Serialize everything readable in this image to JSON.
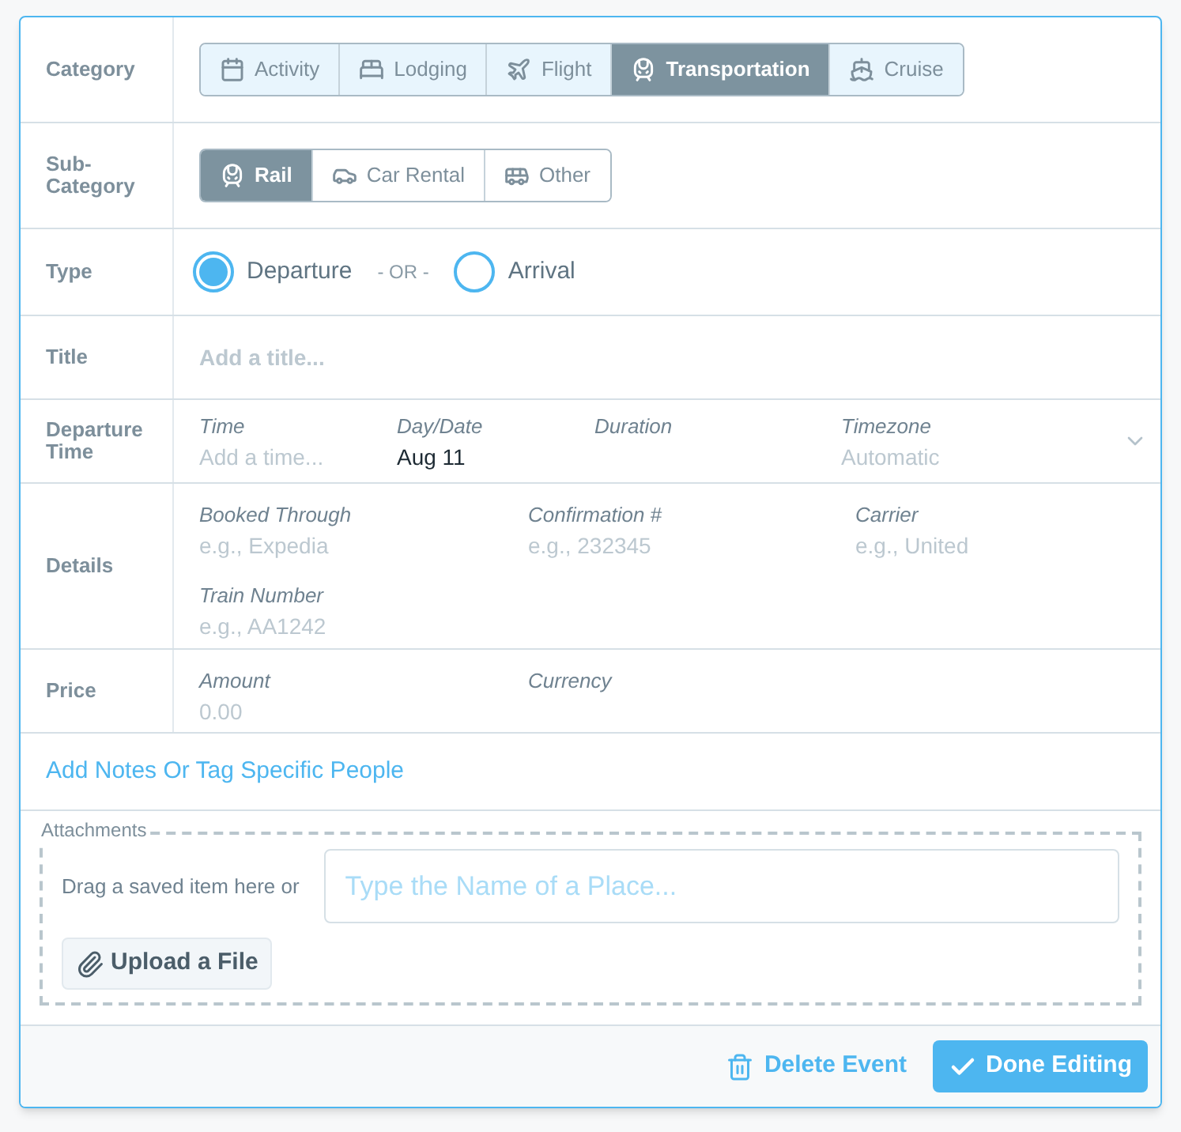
{
  "category": {
    "label": "Category",
    "options": [
      {
        "label": "Activity",
        "selected": false
      },
      {
        "label": "Lodging",
        "selected": false
      },
      {
        "label": "Flight",
        "selected": false
      },
      {
        "label": "Transportation",
        "selected": true
      },
      {
        "label": "Cruise",
        "selected": false
      }
    ]
  },
  "subcategory": {
    "label": "Sub-Category",
    "options": [
      {
        "label": "Rail",
        "selected": true
      },
      {
        "label": "Car Rental",
        "selected": false
      },
      {
        "label": "Other",
        "selected": false
      }
    ]
  },
  "type": {
    "label": "Type",
    "separator": "- OR -",
    "options": [
      {
        "label": "Departure",
        "selected": true
      },
      {
        "label": "Arrival",
        "selected": false
      }
    ]
  },
  "title": {
    "label": "Title",
    "placeholder": "Add a title..."
  },
  "departure_time": {
    "label": "Departure Time",
    "fields": [
      {
        "label": "Time",
        "placeholder": "Add a time..."
      },
      {
        "label": "Day/Date",
        "value": "Aug 11"
      },
      {
        "label": "Duration"
      },
      {
        "label": "Timezone",
        "placeholder": "Automatic",
        "dropdown": true
      }
    ]
  },
  "details": {
    "label": "Details",
    "fields": [
      {
        "label": "Booked Through",
        "placeholder": "e.g., Expedia"
      },
      {
        "label": "Confirmation #",
        "placeholder": "e.g., 232345"
      },
      {
        "label": "Carrier",
        "placeholder": "e.g., United"
      },
      {
        "label": "Train Number",
        "placeholder": "e.g., AA1242"
      }
    ]
  },
  "price": {
    "label": "Price",
    "fields": [
      {
        "label": "Amount",
        "placeholder": "0.00"
      },
      {
        "label": "Currency"
      }
    ]
  },
  "notes_link": "Add Notes Or Tag Specific People",
  "attachments": {
    "legend": "Attachments",
    "drag_text": "Drag a saved item here or",
    "place_placeholder": "Type the Name of a Place...",
    "upload_button": "Upload a File"
  },
  "footer": {
    "delete_button": "Delete Event",
    "done_button": "Done Editing"
  }
}
